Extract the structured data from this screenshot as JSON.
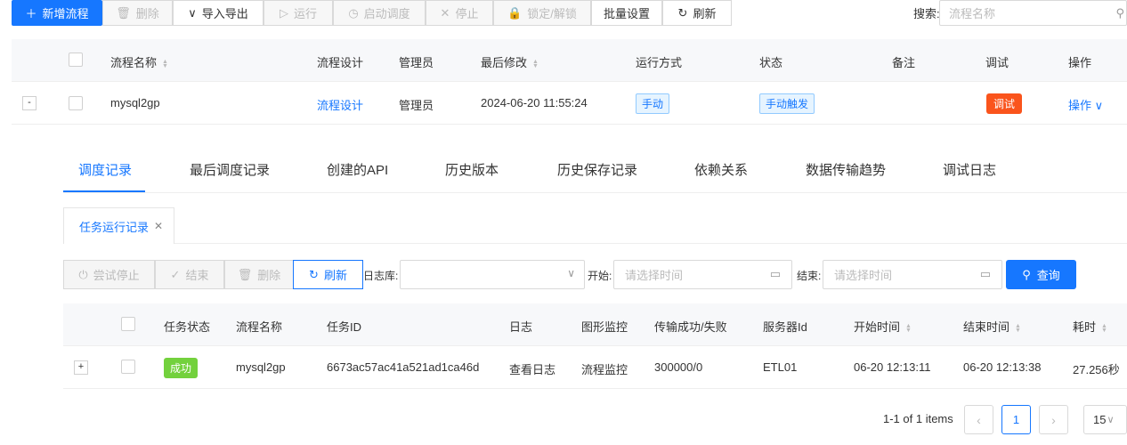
{
  "toolbar": {
    "add": "新增流程",
    "delete": "删除",
    "import_export": "导入导出",
    "run": "运行",
    "start_schedule": "启动调度",
    "stop": "停止",
    "lock_unlock": "锁定/解锁",
    "batch_settings": "批量设置",
    "refresh": "刷新",
    "search_label": "搜索:",
    "search_placeholder": "流程名称"
  },
  "main_table": {
    "headers": {
      "name": "流程名称",
      "design": "流程设计",
      "admin": "管理员",
      "last_modified": "最后修改",
      "run_mode": "运行方式",
      "status": "状态",
      "remark": "备注",
      "debug": "调试",
      "actions": "操作"
    },
    "row": {
      "expand": "-",
      "name": "mysql2gp",
      "design": "流程设计",
      "admin": "管理员",
      "last_modified": "2024-06-20 11:55:24",
      "run_mode": "手动",
      "status": "手动触发",
      "remark": "",
      "debug": "调试",
      "actions": "操作"
    }
  },
  "detail": {
    "tabs": [
      "调度记录",
      "最后调度记录",
      "创建的API",
      "历史版本",
      "历史保存记录",
      "依赖关系",
      "数据传输趋势",
      "调试日志"
    ],
    "subtab": "任务运行记录",
    "buttons": {
      "try_stop": "尝试停止",
      "finish": "结束",
      "delete": "删除",
      "refresh": "刷新",
      "query": "查询"
    },
    "filters": {
      "log_db_label": "日志库:",
      "start_label": "开始:",
      "end_label": "结束:",
      "start_placeholder": "请选择时间",
      "end_placeholder": "请选择时间"
    },
    "table": {
      "headers": {
        "status": "任务状态",
        "name": "流程名称",
        "task_id": "任务ID",
        "log": "日志",
        "graph": "图形监控",
        "transfer": "传输成功/失败",
        "server": "服务器Id",
        "start": "开始时间",
        "end": "结束时间",
        "duration": "耗时"
      },
      "row": {
        "expand": "+",
        "status": "成功",
        "name": "mysql2gp",
        "task_id": "6673ac57ac41a521ad1ca46d",
        "log": "查看日志",
        "graph": "流程监控",
        "transfer": "300000/0",
        "server": "ETL01",
        "start": "06-20 12:13:11",
        "end": "06-20 12:13:38",
        "duration": "27.256秒"
      }
    },
    "pagination": {
      "info": "1-1 of 1 items",
      "current": "1",
      "page_size": "15"
    }
  },
  "colors": {
    "primary": "#1677ff",
    "debug_tag": "#fa541c",
    "success_tag": "#73d13d"
  }
}
